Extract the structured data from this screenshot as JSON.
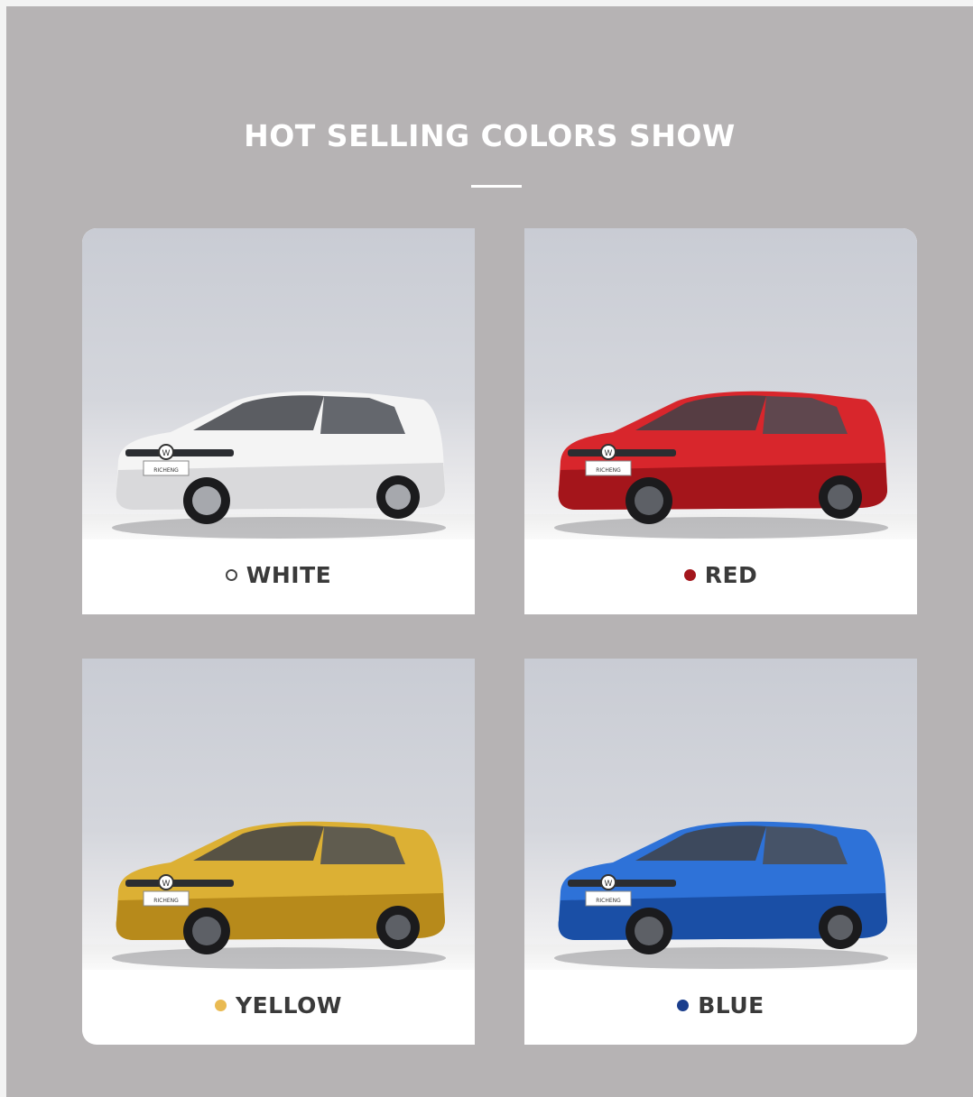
{
  "page": {
    "title": "HOT SELLING COLORS SHOW"
  },
  "colors": [
    {
      "label": "WHITE",
      "dot_color": "#ffffff",
      "body_color": "#f4f4f4",
      "shade_color": "#d9d9db"
    },
    {
      "label": "RED",
      "dot_color": "#a3161c",
      "body_color": "#d8262c",
      "shade_color": "#a4151b"
    },
    {
      "label": "YELLOW",
      "dot_color": "#e9ba52",
      "body_color": "#dcb034",
      "shade_color": "#b78a1b"
    },
    {
      "label": "BLUE",
      "dot_color": "#1a3e8c",
      "body_color": "#2e72d8",
      "shade_color": "#1a4fa6"
    }
  ],
  "plate_text": "RICHENG",
  "badge_icon": "vw-logo-icon"
}
